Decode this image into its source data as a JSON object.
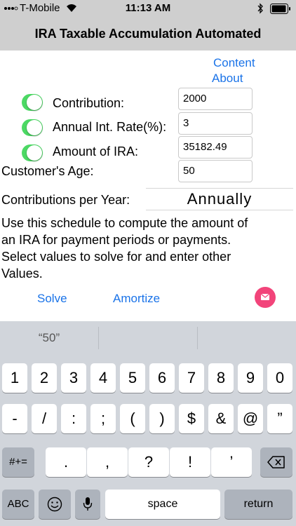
{
  "status_bar": {
    "carrier": "T-Mobile",
    "time": "11:13 AM"
  },
  "nav": {
    "title": "IRA Taxable Accumulation Automated"
  },
  "links": {
    "content": "Content",
    "about": "About"
  },
  "form": {
    "contribution_label": "Contribution:",
    "contribution_value": "2000",
    "rate_label": "Annual Int. Rate(%):",
    "rate_value": "3",
    "amount_label": "Amount of IRA:",
    "amount_value": "35182.49",
    "age_label": "Customer's Age:",
    "age_value": "50",
    "per_year_label": "Contributions per Year:",
    "per_year_value": "Annually"
  },
  "description": [
    "Use this schedule to compute the amount of",
    "an IRA for payment periods or payments.",
    "Select values to solve for and enter other",
    "Values."
  ],
  "actions": {
    "solve": "Solve",
    "amortize": "Amortize"
  },
  "keyboard": {
    "suggestion": "“50”",
    "row1": [
      "1",
      "2",
      "3",
      "4",
      "5",
      "6",
      "7",
      "8",
      "9",
      "0"
    ],
    "row2": [
      "-",
      "/",
      ":",
      ";",
      "(",
      ")",
      "$",
      "&",
      "@",
      "”"
    ],
    "row3": [
      ".",
      ",",
      "?",
      "!",
      "’"
    ],
    "symbols_key": "#+=",
    "abc_key": "ABC",
    "space_key": "space",
    "return_key": "return"
  },
  "colors": {
    "accent": "#1a73e8",
    "toggle_on": "#4cd964",
    "mail_button": "#f2447a",
    "bars": "#cfcfcf"
  }
}
